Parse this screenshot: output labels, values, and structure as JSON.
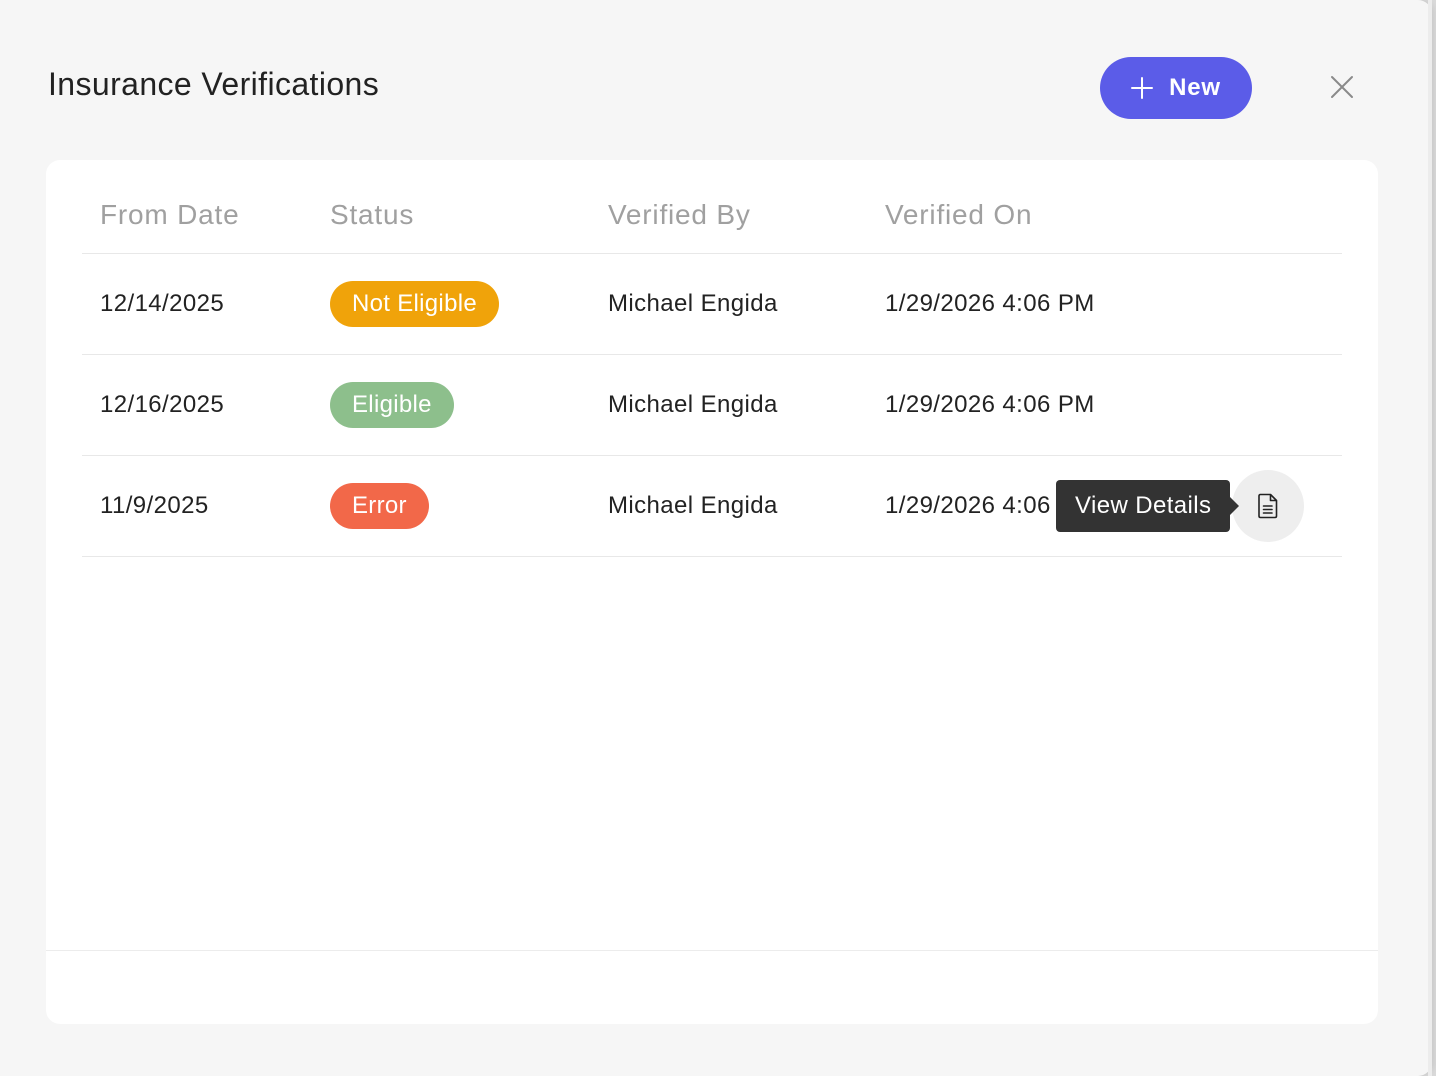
{
  "modal": {
    "title": "Insurance Verifications",
    "new_label": "New",
    "close_icon": "close-icon",
    "accent_color": "#5b5ce8"
  },
  "table": {
    "columns": [
      "From Date",
      "Status",
      "Verified By",
      "Verified On"
    ],
    "rows": [
      {
        "from_date": "12/14/2025",
        "status": "Not Eligible",
        "status_color": "#f0a30a",
        "verified_by": "Michael Engida",
        "verified_on": "1/29/2026 4:06 PM"
      },
      {
        "from_date": "12/16/2025",
        "status": "Eligible",
        "status_color": "#8dbf8c",
        "verified_by": "Michael Engida",
        "verified_on": "1/29/2026 4:06 PM"
      },
      {
        "from_date": "11/9/2025",
        "status": "Error",
        "status_color": "#f26849",
        "verified_by": "Michael Engida",
        "verified_on": "1/29/2026 4:06 PM"
      }
    ]
  },
  "tooltip": {
    "label": "View Details",
    "icon": "document-icon"
  }
}
